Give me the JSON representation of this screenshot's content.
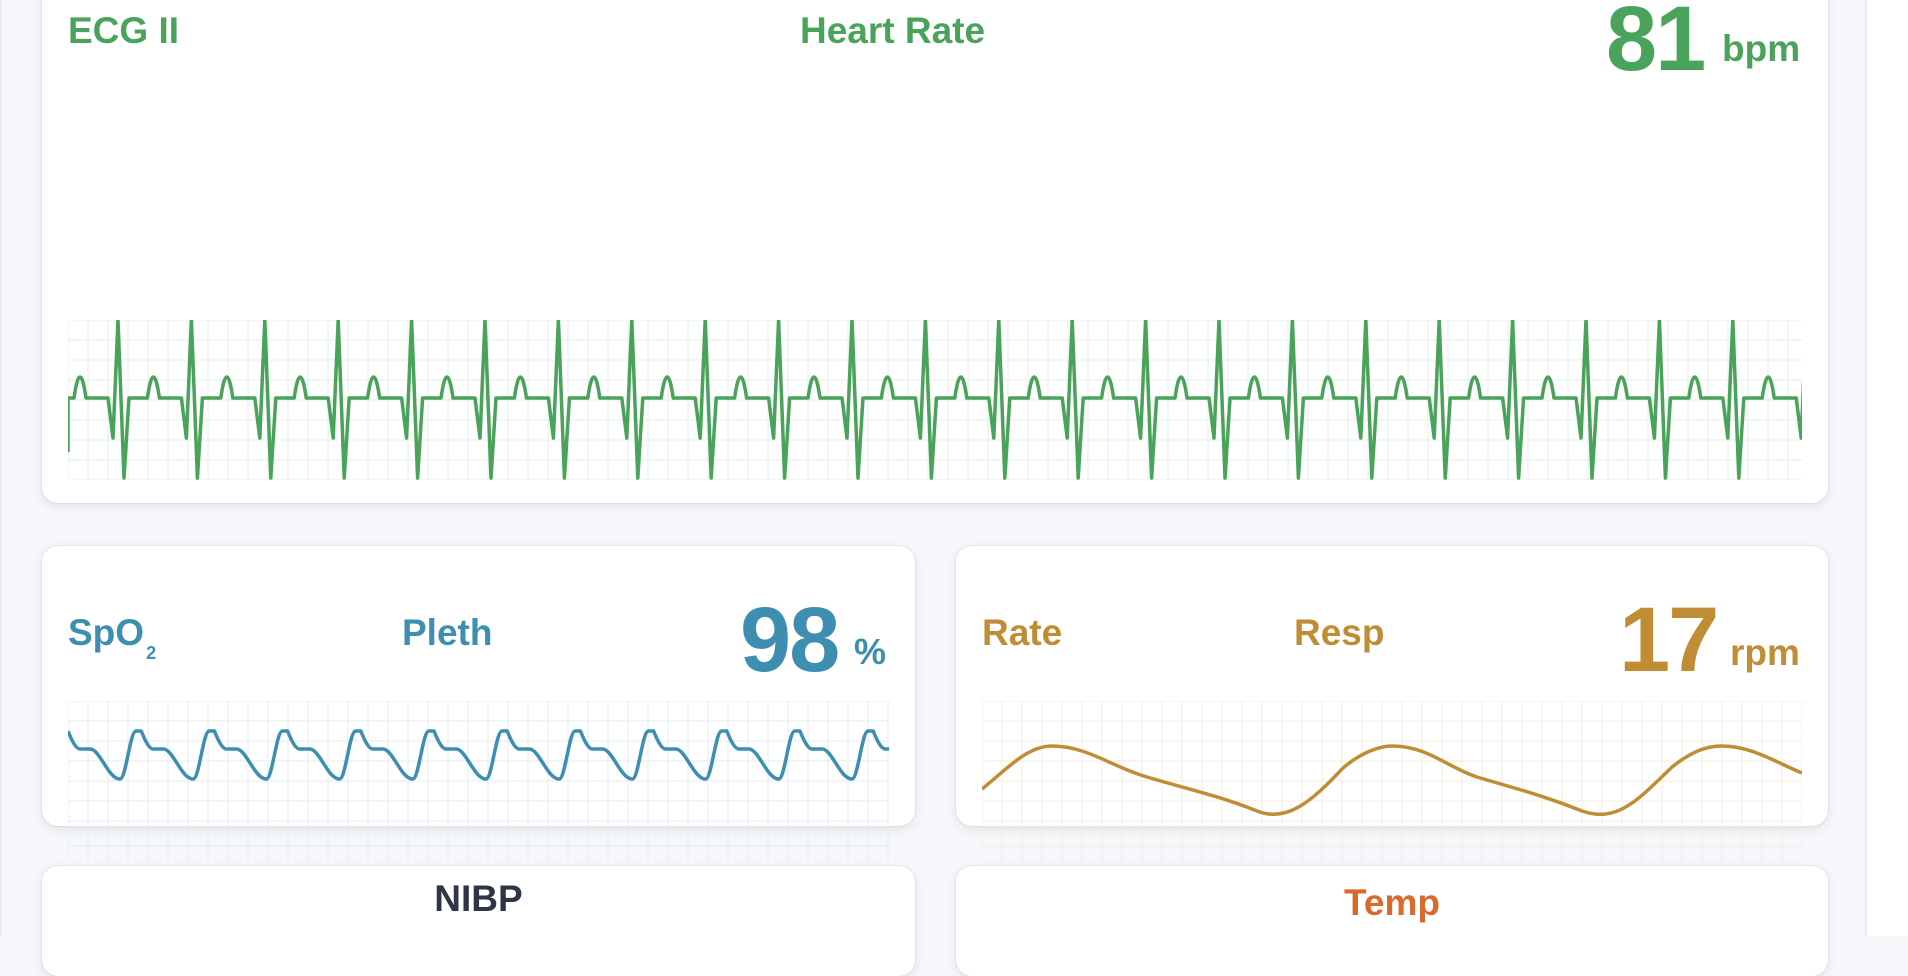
{
  "colors": {
    "ecg": "#4aa35a",
    "spo2": "#3d8eb1",
    "resp": "#c08d35",
    "temp": "#d9692c",
    "nibp": "#2e3545",
    "background": "#f5f7fa"
  },
  "ecg": {
    "lead": "ECG II",
    "title": "Heart Rate",
    "value": "81",
    "unit": "bpm"
  },
  "spo2": {
    "label_main": "SpO",
    "label_sub": "2",
    "title": "Pleth",
    "value": "98",
    "unit": "%"
  },
  "resp": {
    "label": "Rate",
    "title": "Resp",
    "value": "17",
    "unit": "rpm"
  },
  "nibp": {
    "title": "NIBP"
  },
  "temp": {
    "title": "Temp"
  }
}
